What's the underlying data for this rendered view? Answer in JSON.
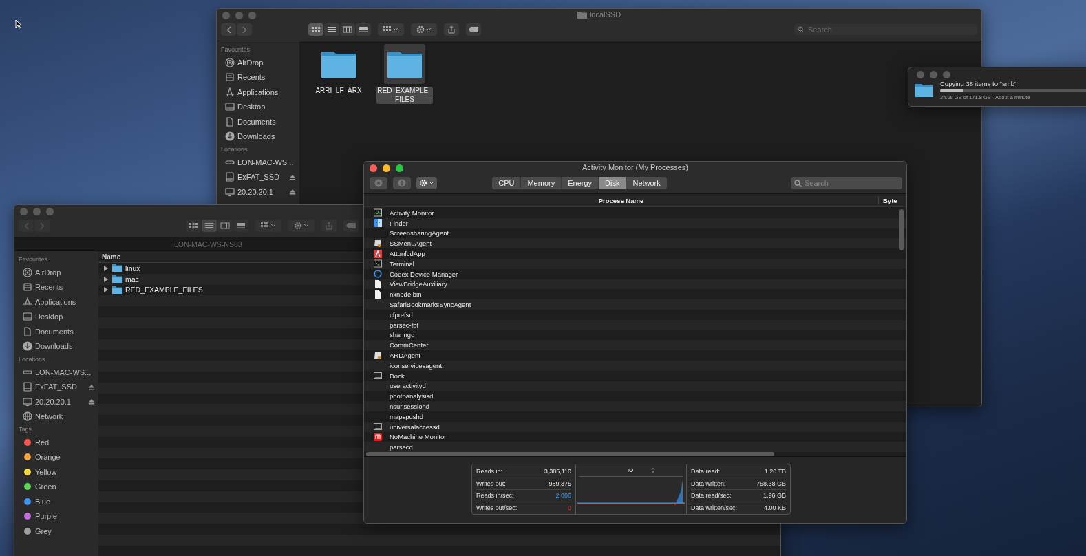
{
  "finder_back": {
    "title": "localSSD",
    "view_modes": [
      {
        "kind": "icons",
        "selected": true
      },
      {
        "kind": "list",
        "selected": false
      },
      {
        "kind": "columns",
        "selected": false
      },
      {
        "kind": "gallery",
        "selected": false
      }
    ],
    "search": {
      "placeholder": "Search"
    },
    "sidebar": [
      {
        "heading": "Favourites",
        "items": [
          {
            "label": "AirDrop",
            "kind": "airdrop"
          },
          {
            "label": "Recents",
            "kind": "recents"
          },
          {
            "label": "Applications",
            "kind": "applications"
          },
          {
            "label": "Desktop",
            "kind": "desktop"
          },
          {
            "label": "Documents",
            "kind": "documents"
          },
          {
            "label": "Downloads",
            "kind": "downloads"
          }
        ]
      },
      {
        "heading": "Locations",
        "items": [
          {
            "label": "LON-MAC-WS...",
            "kind": "server",
            "eject": false
          },
          {
            "label": "ExFAT_SSD",
            "kind": "drive",
            "eject": true
          },
          {
            "label": "20.20.20.1",
            "kind": "display",
            "eject": true
          }
        ]
      }
    ],
    "items": [
      {
        "name": "ARRI_LF_ARX",
        "selected": false
      },
      {
        "name": "RED_EXAMPLE_FILES",
        "selected": true
      }
    ]
  },
  "copy_dialog": {
    "title": "Copying 38 items to \"smb\"",
    "level": 0.14,
    "detail": "24.08 GB of 171.8 GB - About a minute"
  },
  "finder_front": {
    "title": "LON-MAC-WS-NS03",
    "view_modes": [
      {
        "kind": "icons",
        "selected": false
      },
      {
        "kind": "list",
        "selected": true
      },
      {
        "kind": "columns",
        "selected": false
      },
      {
        "kind": "gallery",
        "selected": false
      }
    ],
    "sidebar": [
      {
        "heading": "Favourites",
        "items": [
          {
            "label": "AirDrop",
            "kind": "airdrop"
          },
          {
            "label": "Recents",
            "kind": "recents"
          },
          {
            "label": "Applications",
            "kind": "applications"
          },
          {
            "label": "Desktop",
            "kind": "desktop"
          },
          {
            "label": "Documents",
            "kind": "documents"
          },
          {
            "label": "Downloads",
            "kind": "downloads"
          }
        ]
      },
      {
        "heading": "Locations",
        "items": [
          {
            "label": "LON-MAC-WS...",
            "kind": "server",
            "eject": false
          },
          {
            "label": "ExFAT_SSD",
            "kind": "drive",
            "eject": true
          },
          {
            "label": "20.20.20.1",
            "kind": "display",
            "eject": true
          },
          {
            "label": "Network",
            "kind": "network",
            "eject": false
          }
        ]
      },
      {
        "heading": "Tags",
        "items": [
          {
            "label": "Red",
            "kind": "tag",
            "color": "#f25b55"
          },
          {
            "label": "Orange",
            "kind": "tag",
            "color": "#f5a33c"
          },
          {
            "label": "Yellow",
            "kind": "tag",
            "color": "#f6d63d"
          },
          {
            "label": "Green",
            "kind": "tag",
            "color": "#5fd35c"
          },
          {
            "label": "Blue",
            "kind": "tag",
            "color": "#3f95f3"
          },
          {
            "label": "Purple",
            "kind": "tag",
            "color": "#c46de0"
          },
          {
            "label": "Grey",
            "kind": "tag",
            "color": "#a0a0a2"
          }
        ]
      }
    ],
    "column": "Name",
    "rows": [
      {
        "name": "linux",
        "expanded": false
      },
      {
        "name": "mac",
        "expanded": false
      },
      {
        "name": "RED_EXAMPLE_FILES",
        "expanded": false
      }
    ]
  },
  "activity_monitor": {
    "title": "Activity Monitor (My Processes)",
    "tabs": [
      {
        "label": "CPU",
        "selected": false
      },
      {
        "label": "Memory",
        "selected": false
      },
      {
        "label": "Energy",
        "selected": false
      },
      {
        "label": "Disk",
        "selected": true
      },
      {
        "label": "Network",
        "selected": false
      }
    ],
    "search": {
      "placeholder": "Search"
    },
    "columns": [
      "Process Name",
      "Byte"
    ],
    "processes": [
      {
        "name": "Activity Monitor",
        "kind": "chart"
      },
      {
        "name": "Finder",
        "kind": "face"
      },
      {
        "name": "ScreensharingAgent",
        "kind": "none"
      },
      {
        "name": "SSMenuAgent",
        "kind": "paper"
      },
      {
        "name": "AttonfcdApp",
        "kind": "badge"
      },
      {
        "name": "Terminal",
        "kind": "terminal"
      },
      {
        "name": "Codex Device Manager",
        "kind": "ring"
      },
      {
        "name": "ViewBridgeAuxiliary",
        "kind": "doc"
      },
      {
        "name": "nxnode.bin",
        "kind": "doc"
      },
      {
        "name": "SafariBookmarksSyncAgent",
        "kind": "none"
      },
      {
        "name": "cfprefsd",
        "kind": "none"
      },
      {
        "name": "parsec-fbf",
        "kind": "none"
      },
      {
        "name": "sharingd",
        "kind": "none"
      },
      {
        "name": "CommCenter",
        "kind": "none"
      },
      {
        "name": "ARDAgent",
        "kind": "paper"
      },
      {
        "name": "iconservicesagent",
        "kind": "none"
      },
      {
        "name": "Dock",
        "kind": "screen"
      },
      {
        "name": "useractivityd",
        "kind": "none"
      },
      {
        "name": "photoanalysisd",
        "kind": "none"
      },
      {
        "name": "nsurlsessiond",
        "kind": "none"
      },
      {
        "name": "mapspushd",
        "kind": "none"
      },
      {
        "name": "universalaccessd",
        "kind": "screen"
      },
      {
        "name": "NoMachine Monitor",
        "kind": "bars"
      },
      {
        "name": "parsecd",
        "kind": "none"
      }
    ],
    "stats_left": [
      {
        "label": "Reads in:",
        "value": "3,385,110",
        "kind": "plain"
      },
      {
        "label": "Writes out:",
        "value": "989,375",
        "kind": "plain"
      },
      {
        "label": "Reads in/sec:",
        "value": "2,006",
        "kind": "read"
      },
      {
        "label": "Writes out/sec:",
        "value": "0",
        "kind": "write"
      }
    ],
    "graph_label": "IO",
    "stats_right": [
      {
        "label": "Data read:",
        "value": "1.20 TB"
      },
      {
        "label": "Data written:",
        "value": "758.38 GB"
      },
      {
        "label": "Data read/sec:",
        "value": "1.96 GB"
      },
      {
        "label": "Data written/sec:",
        "value": "4.00 KB"
      }
    ]
  }
}
